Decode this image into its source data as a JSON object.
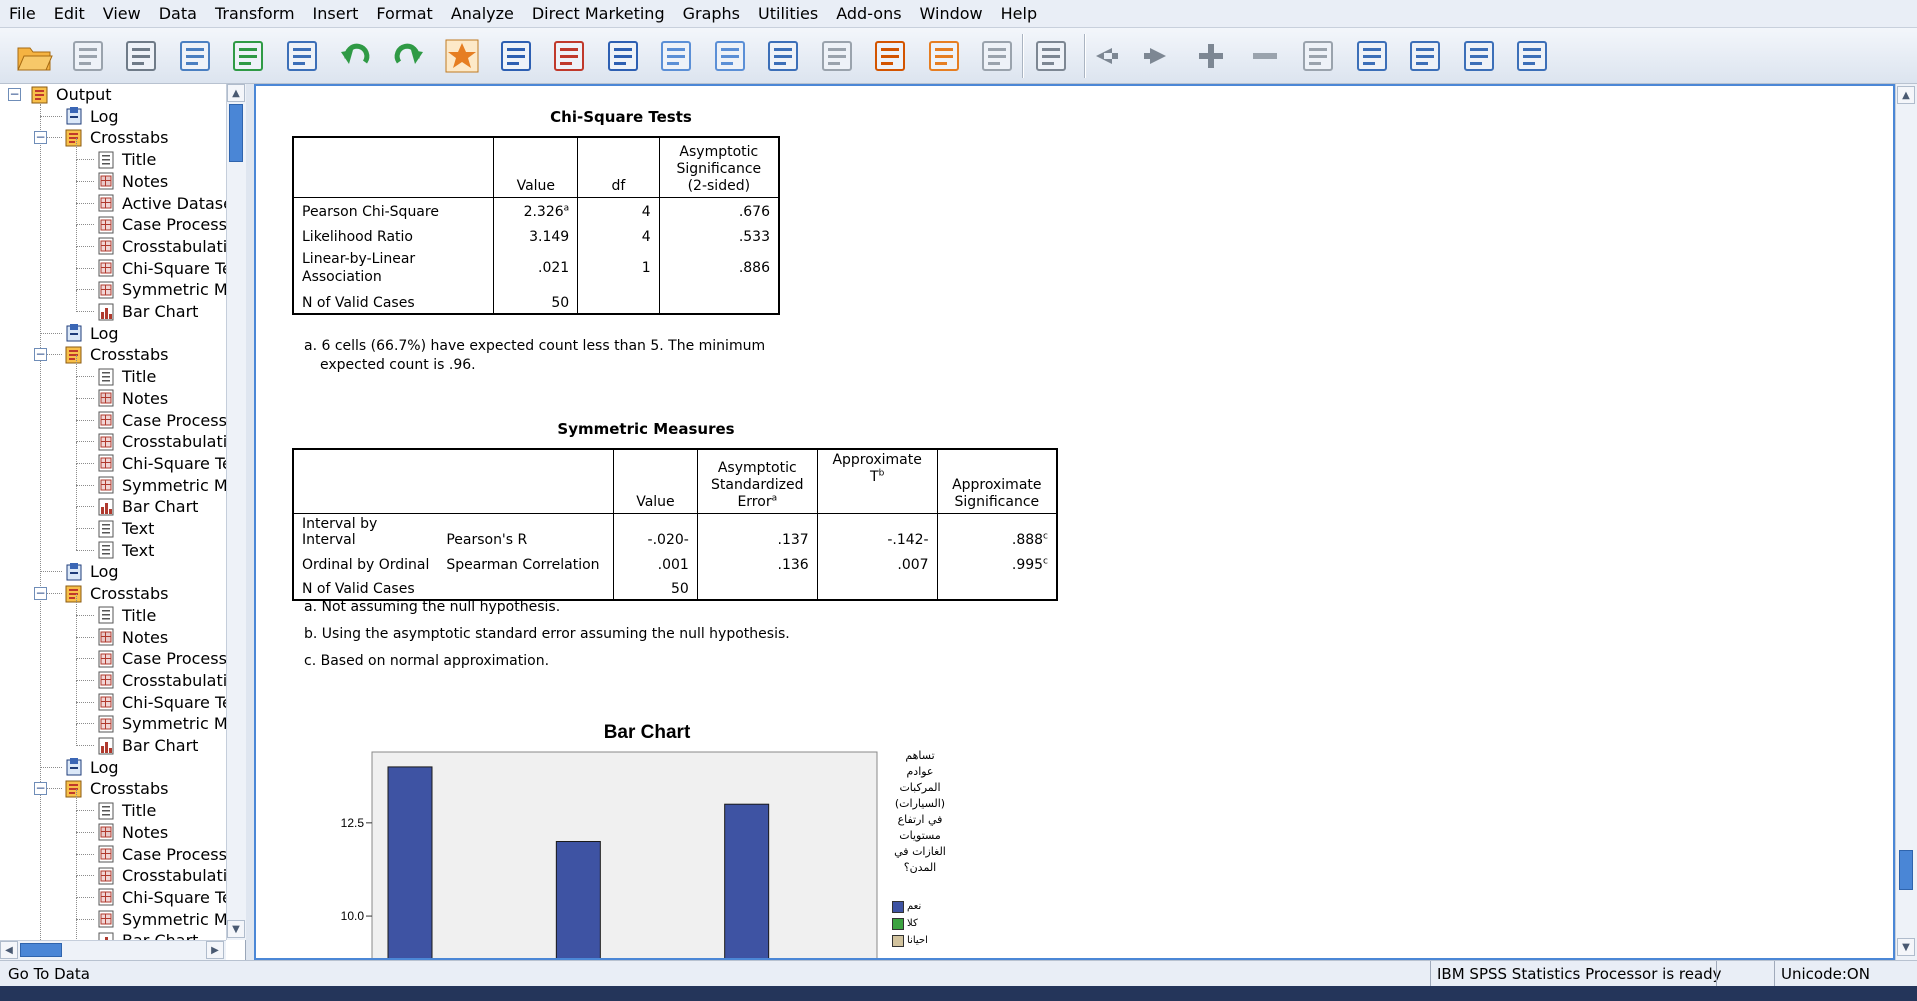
{
  "menu": [
    "File",
    "Edit",
    "View",
    "Data",
    "Transform",
    "Insert",
    "Format",
    "Analyze",
    "Direct Marketing",
    "Graphs",
    "Utilities",
    "Add-ons",
    "Window",
    "Help"
  ],
  "toolbar": {
    "buttons": [
      "open-icon",
      "save-icon",
      "print-icon",
      "print-preview-icon",
      "export-icon",
      "recall-dialog-icon",
      "undo-icon",
      "redo-icon",
      "goto-data-icon",
      "goto-case-icon",
      "goto-variable-icon",
      "variables-icon",
      "show-all-icon",
      "hide-icon",
      "designate-window-icon",
      "promote-icon",
      "demote-icon",
      "insert-heading-icon",
      "insert-title-icon",
      "insert-text-icon",
      "back-icon",
      "forward-icon",
      "expand-icon",
      "collapse-icon",
      "show-icon",
      "hide-selected-icon",
      "insert-page-break-icon",
      "insert-new-title-icon",
      "insert-new-text-icon"
    ]
  },
  "tree": {
    "root": "Output",
    "items": [
      {
        "label": "Log",
        "level": 1,
        "icon": "log-icon"
      },
      {
        "label": "Crosstabs",
        "level": 1,
        "icon": "crosstabs-icon"
      },
      {
        "label": "Title",
        "level": 2,
        "icon": "title-icon"
      },
      {
        "label": "Notes",
        "level": 2,
        "icon": "notes-icon"
      },
      {
        "label": "Active Dataset",
        "level": 2,
        "icon": "table-icon"
      },
      {
        "label": "Case Processi",
        "level": 2,
        "icon": "table-icon"
      },
      {
        "label": "Crosstabulation",
        "level": 2,
        "icon": "table-icon"
      },
      {
        "label": "Chi-Square Tes",
        "level": 2,
        "icon": "table-icon"
      },
      {
        "label": "Symmetric Mea",
        "level": 2,
        "icon": "table-icon"
      },
      {
        "label": "Bar Chart",
        "level": 2,
        "icon": "chart-icon"
      },
      {
        "label": "Log",
        "level": 1,
        "icon": "log-icon"
      },
      {
        "label": "Crosstabs",
        "level": 1,
        "icon": "crosstabs-icon"
      },
      {
        "label": "Title",
        "level": 2,
        "icon": "title-icon"
      },
      {
        "label": "Notes",
        "level": 2,
        "icon": "notes-icon"
      },
      {
        "label": "Case Processi",
        "level": 2,
        "icon": "table-icon"
      },
      {
        "label": "Crosstabulation",
        "level": 2,
        "icon": "table-icon"
      },
      {
        "label": "Chi-Square Tes",
        "level": 2,
        "icon": "table-icon"
      },
      {
        "label": "Symmetric Mea",
        "level": 2,
        "icon": "table-icon"
      },
      {
        "label": "Bar Chart",
        "level": 2,
        "icon": "chart-icon"
      },
      {
        "label": "Text",
        "level": 2,
        "icon": "title-icon"
      },
      {
        "label": "Text",
        "level": 2,
        "icon": "title-icon"
      },
      {
        "label": "Log",
        "level": 1,
        "icon": "log-icon"
      },
      {
        "label": "Crosstabs",
        "level": 1,
        "icon": "crosstabs-icon"
      },
      {
        "label": "Title",
        "level": 2,
        "icon": "title-icon"
      },
      {
        "label": "Notes",
        "level": 2,
        "icon": "notes-icon"
      },
      {
        "label": "Case Processi",
        "level": 2,
        "icon": "table-icon"
      },
      {
        "label": "Crosstabulation",
        "level": 2,
        "icon": "table-icon"
      },
      {
        "label": "Chi-Square Tes",
        "level": 2,
        "icon": "table-icon"
      },
      {
        "label": "Symmetric Mea",
        "level": 2,
        "icon": "table-icon"
      },
      {
        "label": "Bar Chart",
        "level": 2,
        "icon": "chart-icon"
      },
      {
        "label": "Log",
        "level": 1,
        "icon": "log-icon"
      },
      {
        "label": "Crosstabs",
        "level": 1,
        "icon": "crosstabs-icon"
      },
      {
        "label": "Title",
        "level": 2,
        "icon": "title-icon"
      },
      {
        "label": "Notes",
        "level": 2,
        "icon": "notes-icon"
      },
      {
        "label": "Case Processi",
        "level": 2,
        "icon": "table-icon"
      },
      {
        "label": "Crosstabulation",
        "level": 2,
        "icon": "table-icon"
      },
      {
        "label": "Chi-Square Tes",
        "level": 2,
        "icon": "table-icon"
      },
      {
        "label": "Symmetric Mea",
        "level": 2,
        "icon": "table-icon"
      },
      {
        "label": "Bar Chart",
        "level": 2,
        "icon": "chart-icon"
      }
    ]
  },
  "chi_square": {
    "title": "Chi-Square Tests",
    "headers": {
      "value": "Value",
      "df": "df",
      "sig_l1": "Asymptotic",
      "sig_l2": "Significance",
      "sig_l3": "(2-sided)"
    },
    "rows": [
      {
        "label": "Pearson Chi-Square",
        "value": "2.326",
        "sup": "a",
        "df": "4",
        "sig": ".676"
      },
      {
        "label": "Likelihood Ratio",
        "value": "3.149",
        "sup": "",
        "df": "4",
        "sig": ".533"
      },
      {
        "label_l1": "Linear-by-Linear",
        "label_l2": "Association",
        "value": ".021",
        "sup": "",
        "df": "1",
        "sig": ".886"
      },
      {
        "label": "N of Valid Cases",
        "value": "50",
        "sup": "",
        "df": "",
        "sig": ""
      }
    ],
    "footnote_l1": "a. 6 cells (66.7%) have expected count less than 5. The minimum",
    "footnote_l2": "expected count is .96."
  },
  "symmetric": {
    "title": "Symmetric Measures",
    "headers": {
      "value": "Value",
      "ase_l1": "Asymptotic",
      "ase_l2": "Standardized",
      "ase_l3": "Error",
      "ase_sup": "a",
      "t_l1": "Approximate",
      "t_l2": "T",
      "t_sup": "b",
      "sig_l1": "Approximate",
      "sig_l2": "Significance"
    },
    "rows": [
      {
        "group": "Interval by Interval",
        "measure": "Pearson's R",
        "value": "-.020-",
        "ase": ".137",
        "t": "-.142-",
        "sig": ".888",
        "sig_sup": "c"
      },
      {
        "group": "Ordinal by Ordinal",
        "measure": "Spearman Correlation",
        "value": ".001",
        "ase": ".136",
        "t": ".007",
        "sig": ".995",
        "sig_sup": "c"
      },
      {
        "group": "N of Valid Cases",
        "measure": "",
        "value": "50",
        "ase": "",
        "t": "",
        "sig": "",
        "sig_sup": ""
      }
    ],
    "footnotes": [
      "a. Not assuming the null hypothesis.",
      "b. Using the asymptotic standard error assuming the null hypothesis.",
      "c. Based on normal approximation."
    ]
  },
  "chart_data": {
    "type": "bar",
    "title": "Bar Chart",
    "categories": [
      "",
      "",
      ""
    ],
    "series": [
      {
        "name": "نعم",
        "color": "#3e53a3",
        "values": [
          14.0,
          12.0,
          13.0
        ]
      }
    ],
    "yticks": [
      10.0,
      12.5
    ],
    "ytick_labels": [
      "10.0",
      "12.5"
    ],
    "ylim": [
      8.5,
      14.4
    ],
    "legend_title_lines": [
      "تساهم",
      "عوادم",
      "المركبات",
      "(السيارات)",
      "في ارتفاع",
      "مستويات",
      "الغازات في",
      "المدن؟"
    ],
    "legend_items": [
      {
        "label": "نعم",
        "color": "#3e53a3"
      },
      {
        "label": "كلا",
        "color": "#3ca341"
      },
      {
        "label": "احيانا",
        "color": "#d2c39e"
      }
    ]
  },
  "status": {
    "left": "Go To Data",
    "processor": "IBM SPSS Statistics Processor is ready",
    "unicode": "Unicode:ON"
  }
}
